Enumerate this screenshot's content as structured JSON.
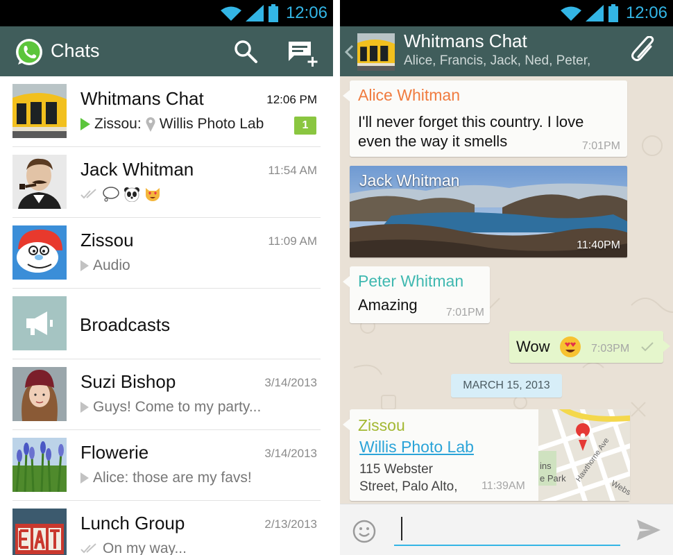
{
  "status": {
    "time": "12:06"
  },
  "left": {
    "title": "Chats",
    "chats": [
      {
        "name": "Whitmans Chat",
        "time": "12:06 PM",
        "preview_sender": "Zissou:",
        "preview": "Willis Photo Lab",
        "unread": "1"
      },
      {
        "name": "Jack Whitman",
        "time": "11:54 AM"
      },
      {
        "name": "Zissou",
        "time": "11:09 AM",
        "preview": "Audio"
      },
      {
        "name": "Broadcasts"
      },
      {
        "name": "Suzi Bishop",
        "time": "3/14/2013",
        "preview": "Guys! Come to my party..."
      },
      {
        "name": "Flowerie",
        "time": "3/14/2013",
        "preview": "Alice: those are my favs!"
      },
      {
        "name": "Lunch Group",
        "time": "2/13/2013",
        "preview": "On my way..."
      }
    ]
  },
  "right": {
    "title": "Whitmans Chat",
    "subtitle": "Alice, Francis, Jack, Ned, Peter,",
    "messages": {
      "alice": {
        "sender": "Alice Whitman",
        "text": "I'll never forget this country. I love even the way it smells",
        "time": "7:01PM"
      },
      "jack": {
        "sender": "Jack Whitman",
        "time": "11:40PM"
      },
      "peter": {
        "sender": "Peter Whitman",
        "text": "Amazing",
        "time": "7:01PM"
      },
      "mine": {
        "text": "Wow",
        "time": "7:03PM"
      },
      "date": "MARCH 15, 2013",
      "zissou": {
        "sender": "Zissou",
        "place": "Willis Photo Lab",
        "address": "115 Webster Street, Palo Alto,",
        "time": "11:39AM"
      }
    },
    "map_labels": {
      "a": "ins",
      "b": "e Park",
      "c": "Hawthorne Ave",
      "d": "Webs"
    }
  },
  "colors": {
    "statusbar": "#000000",
    "actionbar": "#405d5b",
    "clock": "#33b5e5",
    "badge": "#8ac640",
    "alice": "#f07b3f",
    "peter": "#3fb8b0",
    "zissou": "#a3b832",
    "link": "#2aa3d8",
    "outgoing_bubble": "#e5f6cc",
    "date_chip": "#d7eef8"
  }
}
